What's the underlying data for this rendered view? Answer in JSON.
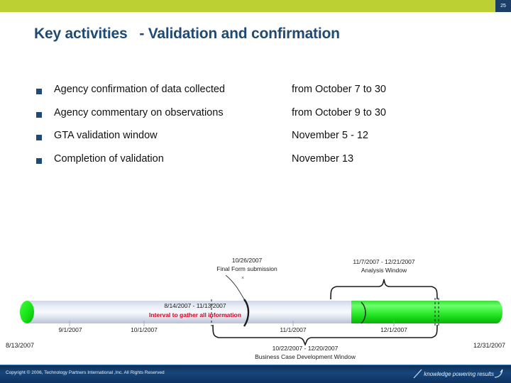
{
  "slide": {
    "number": "25",
    "title": "Key activities   - Validation and confirmation",
    "accent_green": "#bccf33",
    "accent_navy": "#1f4a73"
  },
  "bullets": [
    {
      "text": "Agency confirmation of data collected",
      "value": "from October 7 to 30"
    },
    {
      "text": "Agency commentary on observations",
      "value": "from October 9 to 30"
    },
    {
      "text": "GTA validation window",
      "value": "November 5 - 12"
    },
    {
      "text": "Completion of validation",
      "value": "November 13"
    }
  ],
  "timeline": {
    "start_date": "8/13/2007",
    "end_date": "12/31/2007",
    "ticks": [
      "9/1/2007",
      "10/1/2007",
      "11/1/2007",
      "12/1/2007"
    ],
    "bar_interval_range": "8/14/2007 - 11/13/2007",
    "bar_interval_label": "Interval to gather all information",
    "milestone_date": "10/26/2007",
    "milestone_label": "Final Form submission",
    "analysis_range": "11/7/2007 - 12/21/2007",
    "analysis_label": "Analysis Window",
    "business_case_range": "10/22/2007 - 12/20/2007",
    "business_case_label": "Business Case Development Window",
    "bar_color_complete": "#22ee22",
    "bar_color_pending": "#ccd4e4"
  },
  "footer": {
    "copyright": "Copyright © 2006, Technology Partners International ,Inc.  All Rights Reserved",
    "tagline": "knowledge powering results"
  }
}
